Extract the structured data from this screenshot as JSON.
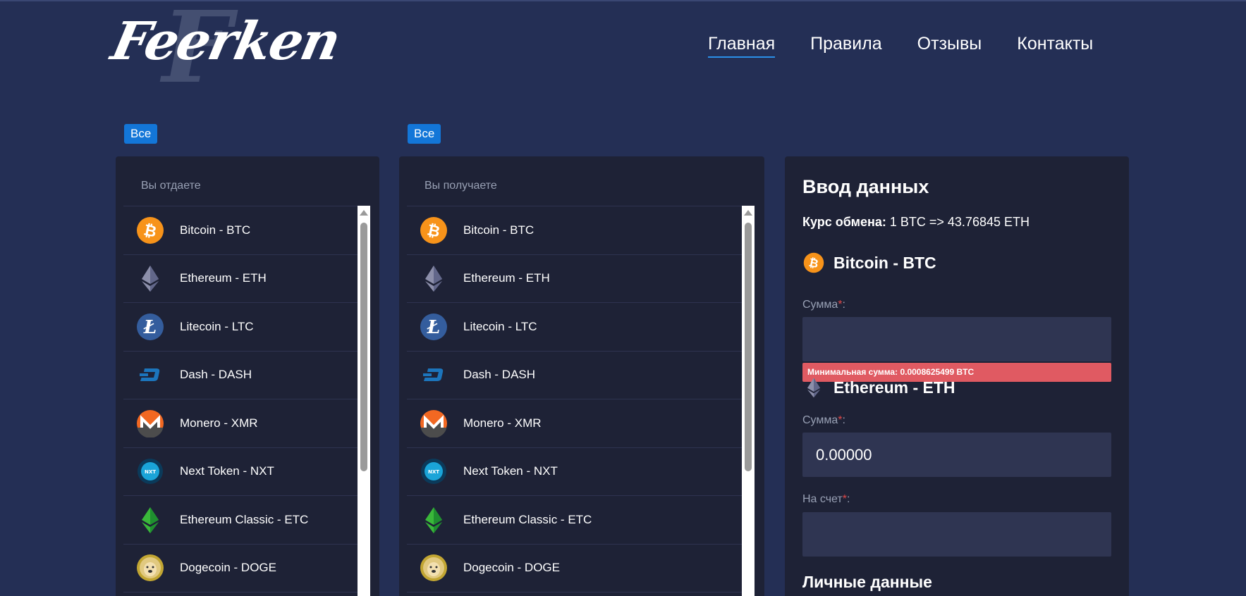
{
  "logo": {
    "text": "Feerken",
    "monogram": "F"
  },
  "nav": [
    {
      "label": "Главная",
      "active": true
    },
    {
      "label": "Правила",
      "active": false
    },
    {
      "label": "Отзывы",
      "active": false
    },
    {
      "label": "Контакты",
      "active": false
    }
  ],
  "give": {
    "filter_label": "Все",
    "header": "Вы отдаете",
    "items": [
      {
        "label": "Bitcoin - BTC",
        "icon": "bitcoin-icon"
      },
      {
        "label": "Ethereum - ETH",
        "icon": "ethereum-icon"
      },
      {
        "label": "Litecoin - LTC",
        "icon": "litecoin-icon"
      },
      {
        "label": "Dash - DASH",
        "icon": "dash-icon"
      },
      {
        "label": "Monero - XMR",
        "icon": "monero-icon"
      },
      {
        "label": "Next Token - NXT",
        "icon": "nxt-icon"
      },
      {
        "label": "Ethereum Classic - ETC",
        "icon": "ethereum-classic-icon"
      },
      {
        "label": "Dogecoin - DOGE",
        "icon": "dogecoin-icon"
      }
    ]
  },
  "receive": {
    "filter_label": "Все",
    "header": "Вы получаете",
    "items": [
      {
        "label": "Bitcoin - BTC",
        "icon": "bitcoin-icon"
      },
      {
        "label": "Ethereum - ETH",
        "icon": "ethereum-icon"
      },
      {
        "label": "Litecoin - LTC",
        "icon": "litecoin-icon"
      },
      {
        "label": "Dash - DASH",
        "icon": "dash-icon"
      },
      {
        "label": "Monero - XMR",
        "icon": "monero-icon"
      },
      {
        "label": "Next Token - NXT",
        "icon": "nxt-icon"
      },
      {
        "label": "Ethereum Classic - ETC",
        "icon": "ethereum-classic-icon"
      },
      {
        "label": "Dogecoin - DOGE",
        "icon": "dogecoin-icon"
      }
    ]
  },
  "form": {
    "title": "Ввод данных",
    "rate_label": "Курс обмена",
    "rate_value": "1 BTC => 43.76845 ETH",
    "give_coin": "Bitcoin - BTC",
    "give_amount_label": "Сумма",
    "give_amount_value": "",
    "min_amount_error": "Минимальная сумма: 0.0008625499 BTC",
    "receive_coin": "Ethereum - ETH",
    "receive_amount_label": "Сумма",
    "receive_amount_value": "0.00000",
    "account_label": "На счет",
    "account_value": "",
    "personal_title": "Личные данные"
  },
  "colors": {
    "background": "#242f55",
    "panel": "#1e2236",
    "accent": "#1376d8",
    "error": "#e05a62",
    "bitcoin": "#f7931a",
    "litecoin": "#345d9d",
    "dash": "#1c75bc",
    "monero": "#f26822",
    "etc": "#3ab83a"
  }
}
